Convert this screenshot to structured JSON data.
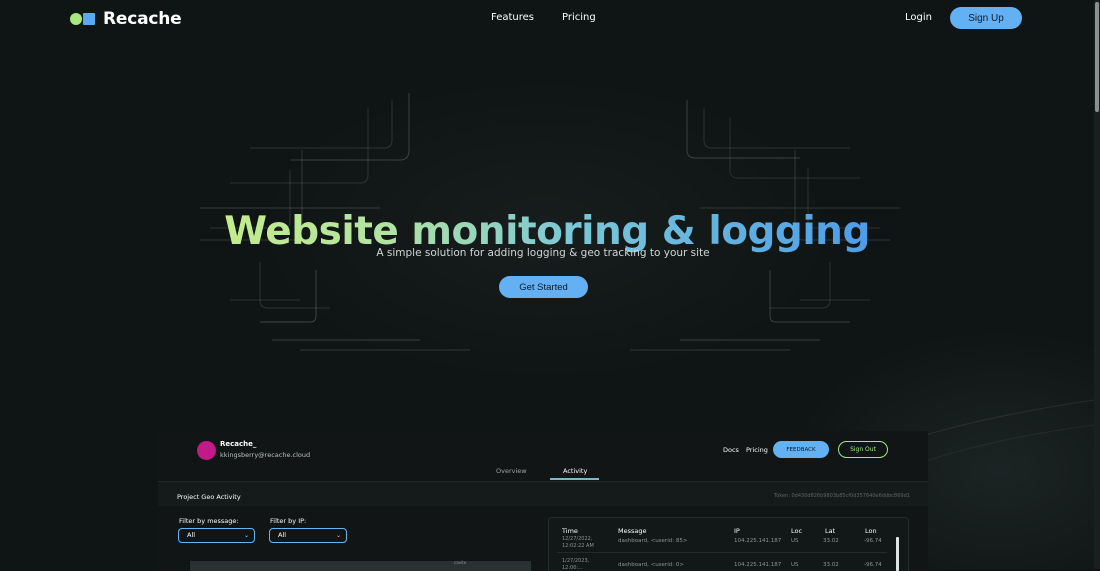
{
  "brand": {
    "name": "Recache",
    "colors": {
      "accent_green": "#a6e87d",
      "accent_blue": "#63b0f2",
      "background": "#0f1514"
    }
  },
  "nav": {
    "links": [
      "Features",
      "Pricing"
    ],
    "login": "Login",
    "signup": "Sign Up"
  },
  "hero": {
    "title": "Website monitoring & logging",
    "subtitle": "A simple solution for adding logging & geo tracking to your site",
    "cta": "Get Started"
  },
  "dashboard": {
    "user": {
      "name": "Recache_",
      "email": "kkingsberry@recache.cloud",
      "avatar_color": "#c21a86"
    },
    "header_links": [
      "Docs",
      "Pricing"
    ],
    "feedback": "FEEDBACK",
    "signout": "Sign Out",
    "tabs": [
      {
        "label": "Overview",
        "active": false
      },
      {
        "label": "Activity",
        "active": true
      }
    ],
    "section_title": "Project Geo Activity",
    "token": "Token: 0d430d826b9803b85cf0d357640e6ddbc869d1",
    "filters": {
      "message_label": "Filter by message:",
      "message_value": "All",
      "ip_label": "Filter by IP:",
      "ip_value": "All"
    },
    "map_label": "cavite",
    "table": {
      "headers": [
        "Time",
        "Message",
        "IP",
        "Loc",
        "Lat",
        "Lon"
      ],
      "rows": [
        {
          "time": "12/27/2022, 12:02:22 AM",
          "message": "dashboard, <userid: 85>",
          "ip": "104.225.141.187",
          "loc": "US",
          "lat": "33.02",
          "lon": "-96.74"
        },
        {
          "time": "1/27/2023, 12:00:...",
          "message": "dashboard, <userid: 0>",
          "ip": "104.225.141.187",
          "loc": "US",
          "lat": "33.02",
          "lon": "-96.74"
        }
      ]
    }
  }
}
